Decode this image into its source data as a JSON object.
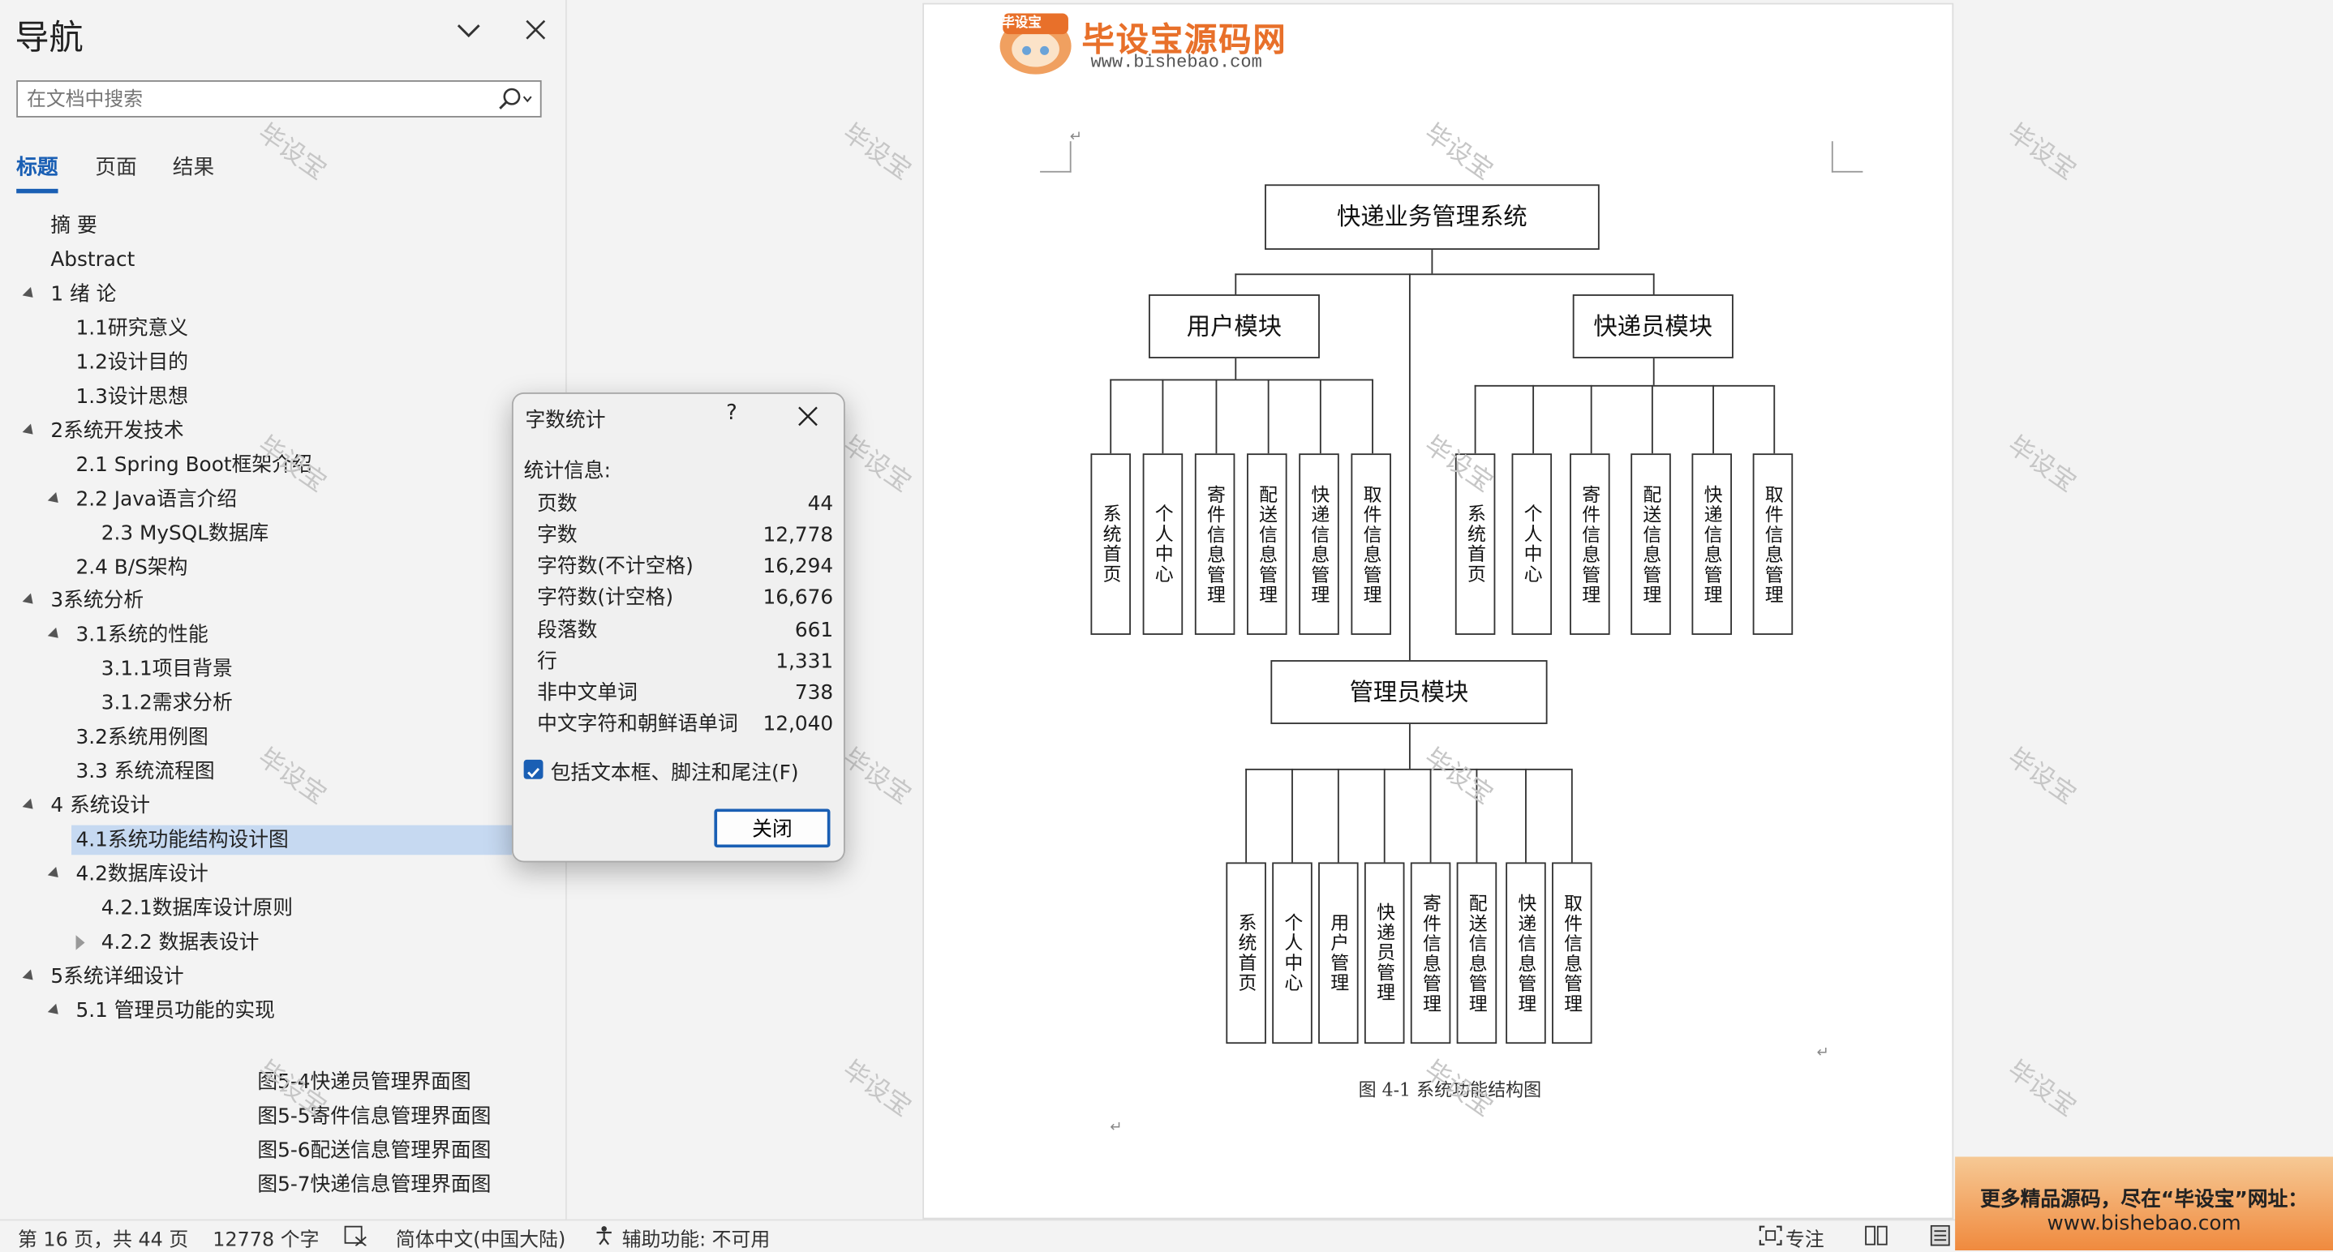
{
  "nav": {
    "title": "导航",
    "search_placeholder": "在文档中搜索",
    "tabs": [
      {
        "label": "标题",
        "active": true
      },
      {
        "label": "页面",
        "active": false
      },
      {
        "label": "结果",
        "active": false
      }
    ],
    "headings": [
      {
        "text": "摘  要",
        "level": 1,
        "toggle": "none"
      },
      {
        "text": "Abstract",
        "level": 1,
        "toggle": "none"
      },
      {
        "text": "1 绪  论",
        "level": 1,
        "toggle": "expanded"
      },
      {
        "text": "1.1研究意义",
        "level": 2,
        "toggle": "none"
      },
      {
        "text": "1.2设计目的",
        "level": 2,
        "toggle": "none"
      },
      {
        "text": "1.3设计思想",
        "level": 2,
        "toggle": "none"
      },
      {
        "text": "2系统开发技术",
        "level": 1,
        "toggle": "expanded"
      },
      {
        "text": "2.1 Spring Boot框架介绍",
        "level": 2,
        "toggle": "none"
      },
      {
        "text": "2.2 Java语言介绍",
        "level": 2,
        "toggle": "expanded"
      },
      {
        "text": "2.3 MySQL数据库",
        "level": 3,
        "toggle": "none"
      },
      {
        "text": "2.4 B/S架构",
        "level": 2,
        "toggle": "none"
      },
      {
        "text": "3系统分析",
        "level": 1,
        "toggle": "expanded"
      },
      {
        "text": "3.1系统的性能",
        "level": 2,
        "toggle": "expanded"
      },
      {
        "text": "3.1.1项目背景",
        "level": 3,
        "toggle": "none"
      },
      {
        "text": "3.1.2需求分析",
        "level": 3,
        "toggle": "none"
      },
      {
        "text": "3.2系统用例图",
        "level": 2,
        "toggle": "none"
      },
      {
        "text": "3.3 系统流程图",
        "level": 2,
        "toggle": "none"
      },
      {
        "text": "4 系统设计",
        "level": 1,
        "toggle": "expanded"
      },
      {
        "text": "4.1系统功能结构设计图",
        "level": 2,
        "toggle": "none",
        "selected": true
      },
      {
        "text": "4.2数据库设计",
        "level": 2,
        "toggle": "expanded"
      },
      {
        "text": "4.2.1数据库设计原则",
        "level": 3,
        "toggle": "none"
      },
      {
        "text": "4.2.2  数据表设计",
        "level": 3,
        "toggle": "collapsed"
      },
      {
        "text": "5系统详细设计",
        "level": 1,
        "toggle": "expanded"
      },
      {
        "text": "5.1 管理员功能的实现",
        "level": 2,
        "toggle": "expanded"
      }
    ],
    "figure_items": [
      "图5-4快递员管理界面图",
      "图5-5寄件信息管理界面图",
      "图5-6配送信息管理界面图",
      "图5-7快递信息管理界面图"
    ]
  },
  "dialog": {
    "title": "字数统计",
    "help": "?",
    "stats_label": "统计信息:",
    "stats": [
      {
        "label": "页数",
        "value": "44"
      },
      {
        "label": "字数",
        "value": "12,778"
      },
      {
        "label": "字符数(不计空格)",
        "value": "16,294"
      },
      {
        "label": "字符数(计空格)",
        "value": "16,676"
      },
      {
        "label": "段落数",
        "value": "661"
      },
      {
        "label": "行",
        "value": "1,331"
      },
      {
        "label": "非中文单词",
        "value": "738"
      },
      {
        "label": "中文字符和朝鲜语单词",
        "value": "12,040"
      }
    ],
    "checkbox_label": "包括文本框、脚注和尾注(F)",
    "checkbox_checked": true,
    "close_label": "关闭"
  },
  "document": {
    "logo_title": "毕设宝源码网",
    "logo_badge": "毕设宝",
    "logo_url": "www.bishebao.com",
    "root": "快递业务管理系统",
    "user_module": "用户模块",
    "courier_module": "快递员模块",
    "admin_module": "管理员模块",
    "user_items": [
      "系统首页",
      "个人中心",
      "寄件信息管理",
      "配送信息管理",
      "快递信息管理",
      "取件信息管理"
    ],
    "courier_items": [
      "系统首页",
      "个人中心",
      "寄件信息管理",
      "配送信息管理",
      "快递信息管理",
      "取件信息管理"
    ],
    "admin_items": [
      "系统首页",
      "个人中心",
      "用户管理",
      "快递员管理",
      "寄件信息管理",
      "配送信息管理",
      "快递信息管理",
      "取件信息管理"
    ],
    "caption": "图 4-1 系统功能结构图",
    "watermark": "毕设宝"
  },
  "status": {
    "page": "第 16 页，共 44 页",
    "words": "12778 个字",
    "language": "简体中文(中国大陆)",
    "accessibility": "辅助功能: 不可用",
    "focus": "专注"
  },
  "banner": {
    "line1": "更多精品源码，尽在“毕设宝”网址：",
    "line2": "www.bishebao.com"
  },
  "colors": {
    "accent": "#1a5fb4",
    "selection": "#c6d9f1",
    "banner": "#f08a3e"
  }
}
